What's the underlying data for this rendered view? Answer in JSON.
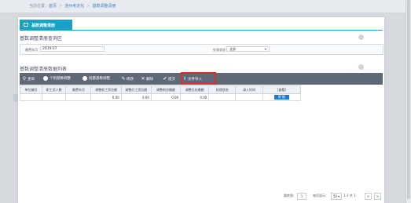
{
  "breadcrumb": {
    "prefix": "当前位置：",
    "items": [
      "首页",
      "池州考定化",
      "基数调整清册"
    ]
  },
  "tab": {
    "title": "基数调整清册"
  },
  "query_section": {
    "title": "基数调整清册查询区",
    "period_label": "缴费年月",
    "period_value": "2019.07",
    "status_label": "处理状态",
    "status_value": "全部"
  },
  "list_section": {
    "title": "基数调整清册数据列表"
  },
  "toolbar": {
    "query": "查询",
    "single_adjust": "个别基数调整",
    "batch_adjust": "批量基数调整",
    "modify": "修改",
    "delete": "删除",
    "submit": "提交",
    "import": "文件导入"
  },
  "table": {
    "headers": [
      "单位编号",
      "职工总人数",
      "缴费年月",
      "调整前工资总额",
      "调整后工资总额",
      "调整前应缴额",
      "调整后应缴额",
      "处理状态",
      "录入时间",
      "[查看]"
    ],
    "row": [
      "",
      "",
      "",
      "0.00",
      "0.00",
      "0.00",
      "0.00",
      "",
      "",
      "明 细"
    ]
  },
  "pager": {
    "jump_label": "跳转到:",
    "page_value": "1",
    "per_page_label": "每页显示:",
    "per_page_value": "50",
    "summary": "1-1 共 1",
    "prev": "<",
    "next": ">"
  },
  "colors": {
    "accent": "#17a2c6",
    "toolbar": "#5e6877",
    "highlight": "#e02c2c"
  }
}
